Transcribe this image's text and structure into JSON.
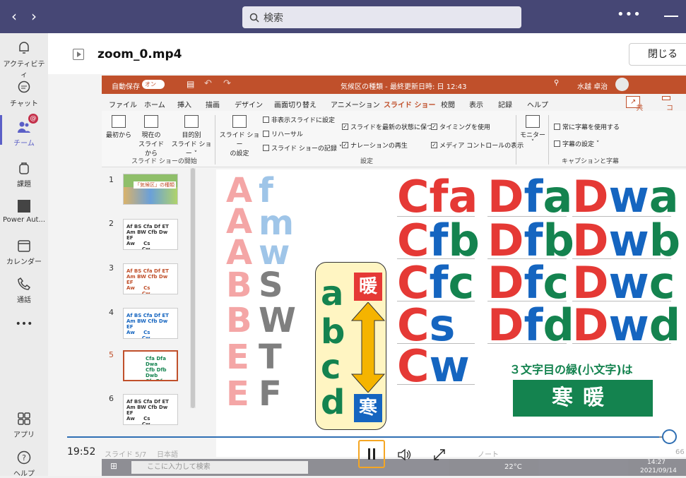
{
  "teams": {
    "search_placeholder": "検索",
    "more": "•••",
    "rail": [
      {
        "label": "アクティビティ"
      },
      {
        "label": "チャット"
      },
      {
        "label": "チーム"
      },
      {
        "label": "課題"
      },
      {
        "label": "Power Aut..."
      },
      {
        "label": "カレンダー"
      },
      {
        "label": "通話"
      },
      {
        "label": "•••"
      },
      {
        "label": "アプリ"
      },
      {
        "label": "ヘルプ"
      }
    ],
    "badge": "@"
  },
  "file": {
    "name": "zoom_0.mp4",
    "close_label": "閉じる"
  },
  "ppt": {
    "autosave": "自動保存",
    "autosave_state": "オン",
    "title": "気候区の種類 - 最終更新日時: 日 12:43",
    "user": "水越 卓治",
    "share": "共有",
    "comment": "コメ",
    "tabs": [
      "ファイル",
      "ホーム",
      "挿入",
      "描画",
      "デザイン",
      "画面切り替え",
      "アニメーション",
      "スライド ショー",
      "校閲",
      "表示",
      "記録",
      "ヘルプ"
    ],
    "ribbon": {
      "from_start": "最初から",
      "from_current_1": "現在の",
      "from_current_2": "スライドから",
      "custom_1": "目的別",
      "custom_2": "スライド ショー",
      "group_start": "スライド ショーの開始",
      "setup_1": "スライド ショー",
      "setup_2": "の設定",
      "hide_slide": "非表示スライドに設定",
      "rehearse": "リハーサル",
      "record": "スライド ショーの記録",
      "keep_updated": "スライドを最新の状態に保つ",
      "narration": "ナレーションの再生",
      "timing": "タイミングを使用",
      "media_controls": "メディア コントロールの表示",
      "group_setup": "設定",
      "monitor": "モニター",
      "always_subtitles": "常に字幕を使用する",
      "subtitle_settings": "字幕の設定",
      "group_captions": "キャプションと字幕"
    },
    "thumbs": [
      {
        "num": "1",
        "title": "「気候区」の種類"
      },
      {
        "num": "2"
      },
      {
        "num": "3"
      },
      {
        "num": "4"
      },
      {
        "num": "5"
      },
      {
        "num": "6"
      }
    ],
    "slide": {
      "col1": [
        "A",
        "A",
        "A",
        "B",
        "B",
        "E",
        "E"
      ],
      "col2": [
        "f",
        "m",
        "w",
        "S",
        "W",
        "T",
        "F"
      ],
      "lower": [
        "a",
        "b",
        "c",
        "d"
      ],
      "warm": "暖",
      "cold": "寒",
      "c_col": [
        "Cfa",
        "Cfb",
        "Cfc",
        "Cs",
        "Cw"
      ],
      "d_col": [
        "Dfa",
        "Dfb",
        "Dfc",
        "Dfd"
      ],
      "dw_col": [
        "Dwa",
        "Dwb",
        "Dwc",
        "Dwd"
      ],
      "caption": "３文字目の緑(小文字)は",
      "box": "寒暖"
    },
    "status": {
      "slide": "スライド 5/7",
      "lang": "日本語",
      "notes": "ノート",
      "zoom": "66"
    },
    "taskbar": {
      "search": "ここに入力して検索",
      "temp": "22°C",
      "time": "14:27",
      "date": "2021/09/14"
    }
  },
  "player": {
    "time": "19:52",
    "progress": 0.98
  },
  "colors": {
    "teams_bar": "#464775",
    "ppt_accent": "#c0502b",
    "slide_red": "#e53935",
    "slide_green": "#14834f",
    "slide_blue": "#1565c0"
  }
}
